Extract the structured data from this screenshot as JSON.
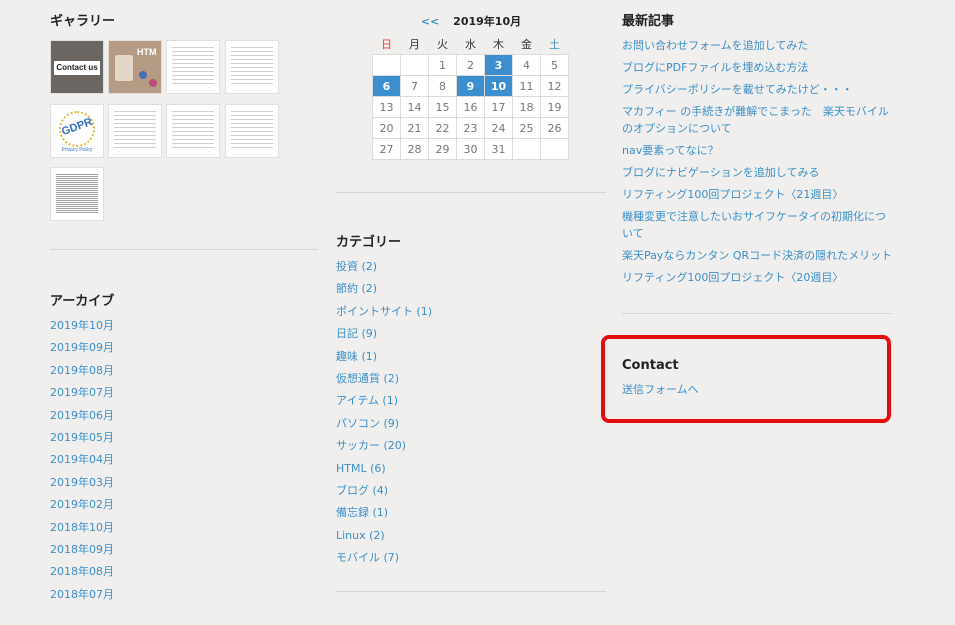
{
  "gallery": {
    "title": "ギャラリー",
    "thumbs": [
      {
        "label": "Contact us",
        "icon": "contact-us-thumbnail"
      },
      {
        "label": "HTM",
        "icon": "html-desk-thumbnail"
      },
      {
        "icon": "document-thumbnail"
      },
      {
        "icon": "document-thumbnail"
      },
      {
        "label": "GDPR",
        "sub": "Privacy Policy",
        "icon": "gdpr-thumbnail"
      },
      {
        "icon": "document-thumbnail"
      },
      {
        "icon": "document-thumbnail"
      },
      {
        "icon": "document-thumbnail"
      },
      {
        "icon": "dense-document-thumbnail"
      }
    ]
  },
  "archive": {
    "title": "アーカイブ",
    "items": [
      "2019年10月",
      "2019年09月",
      "2019年08月",
      "2019年07月",
      "2019年06月",
      "2019年05月",
      "2019年04月",
      "2019年03月",
      "2019年02月",
      "2018年10月",
      "2018年09月",
      "2018年08月",
      "2018年07月"
    ]
  },
  "calendar": {
    "prev": "<<",
    "month": "2019年10月",
    "weekdays": [
      "日",
      "月",
      "火",
      "水",
      "木",
      "金",
      "土"
    ],
    "weeks": [
      [
        "",
        "",
        "1",
        "2",
        "3",
        "4",
        "5"
      ],
      [
        "6",
        "7",
        "8",
        "9",
        "10",
        "11",
        "12"
      ],
      [
        "13",
        "14",
        "15",
        "16",
        "17",
        "18",
        "19"
      ],
      [
        "20",
        "21",
        "22",
        "23",
        "24",
        "25",
        "26"
      ],
      [
        "27",
        "28",
        "29",
        "30",
        "31",
        "",
        ""
      ]
    ],
    "linked_days": [
      "3",
      "6",
      "9",
      "10"
    ]
  },
  "category": {
    "title": "カテゴリー",
    "items": [
      {
        "name": "投資",
        "count": "(2)"
      },
      {
        "name": "節約",
        "count": "(2)"
      },
      {
        "name": "ポイントサイト",
        "count": "(1)"
      },
      {
        "name": "日記",
        "count": "(9)"
      },
      {
        "name": "趣味",
        "count": "(1)"
      },
      {
        "name": "仮想通貨",
        "count": "(2)"
      },
      {
        "name": "アイテム",
        "count": "(1)"
      },
      {
        "name": "パソコン",
        "count": "(9)"
      },
      {
        "name": "サッカー",
        "count": "(20)"
      },
      {
        "name": "HTML",
        "count": "(6)"
      },
      {
        "name": "ブログ",
        "count": "(4)"
      },
      {
        "name": "備忘録",
        "count": "(1)"
      },
      {
        "name": "Linux",
        "count": "(2)"
      },
      {
        "name": "モバイル",
        "count": "(7)"
      }
    ]
  },
  "recent": {
    "title": "最新記事",
    "items": [
      "お問い合わせフォームを追加してみた",
      "ブログにPDFファイルを埋め込む方法",
      "プライバシーポリシーを載せてみたけど・・・",
      "マカフィー の手続きが難解でこまった　楽天モバイルのオプションについて",
      "nav要素ってなに？",
      "ブログにナビゲーションを追加してみる",
      "リフティング100回プロジェクト〈21週目〉",
      "機種変更で注意したいおサイフケータイの初期化について",
      "楽天Payならカンタン QRコード決済の隠れたメリット",
      "リフティング100回プロジェクト〈20週目〉"
    ]
  },
  "contact": {
    "title": "Contact",
    "link": "送信フォームへ"
  },
  "colors": {
    "background": "#f0efed",
    "link": "#3a8fc8",
    "calendar_highlight": "#3b8fcf",
    "sunday": "#e0413b",
    "saturday": "#3a8fc8",
    "annotation_box": "#e20e0e"
  }
}
